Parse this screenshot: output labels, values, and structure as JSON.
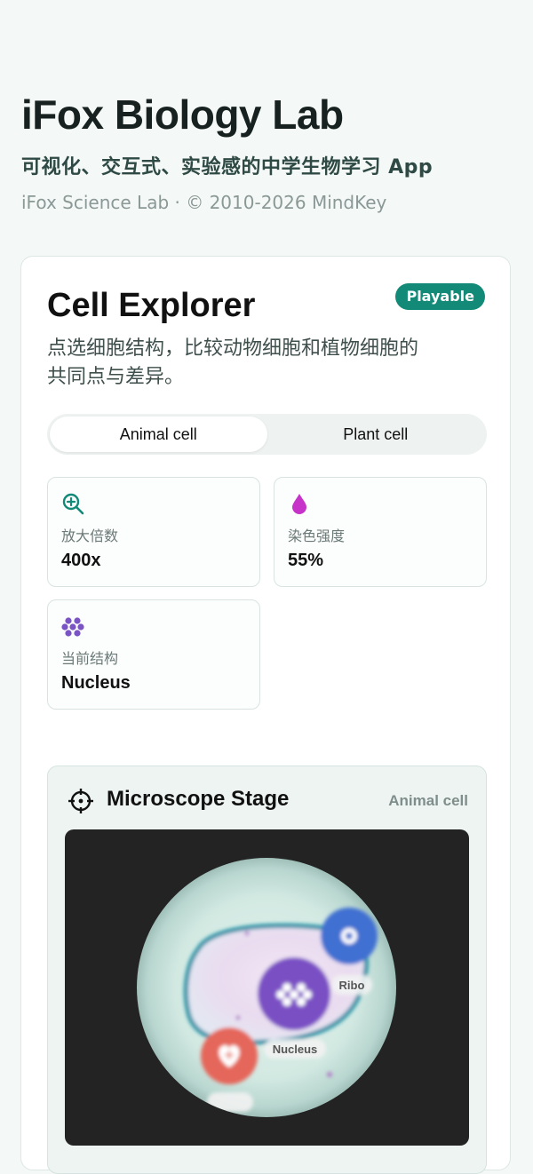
{
  "header": {
    "title": "iFox Biology Lab",
    "subtitle": "可视化、交互式、实验感的中学生物学习 App",
    "copyright": "iFox Science Lab · © 2010-2026 MindKey"
  },
  "card": {
    "title": "Cell Explorer",
    "badge": "Playable",
    "description": "点选细胞结构，比较动物细胞和植物细胞的共同点与差异。",
    "tabs": [
      {
        "label": "Animal cell",
        "active": true
      },
      {
        "label": "Plant cell",
        "active": false
      }
    ],
    "stats": [
      {
        "icon": "zoom-in-icon",
        "label": "放大倍数",
        "value": "400x",
        "color": "#138a78"
      },
      {
        "icon": "droplet-icon",
        "label": "染色强度",
        "value": "55%",
        "color": "#c733c9"
      },
      {
        "icon": "organelle-cluster-icon",
        "label": "当前结构",
        "value": "Nucleus",
        "color": "#7a53c4"
      }
    ]
  },
  "stage": {
    "icon": "crosshair-icon",
    "title": "Microscope Stage",
    "mode": "Animal cell",
    "labels": {
      "ribo": "Ribo",
      "nucleus": "Nucleus"
    }
  },
  "colors": {
    "accent": "#138a78",
    "nucleus": "#7a4fc4",
    "ribosome": "#3f6fd1",
    "lysosome": "#e5665a",
    "membrane": "#1e8fa4"
  }
}
